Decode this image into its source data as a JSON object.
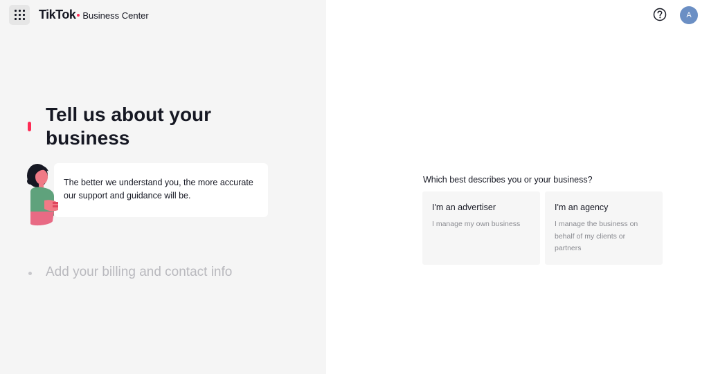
{
  "header": {
    "brand_name": "TikTok",
    "brand_product": "Business Center",
    "apps_icon": "grid-icon",
    "help_icon": "question-circle-icon",
    "avatar_initial": "A",
    "avatar_color": "#6b8fc4"
  },
  "steps": {
    "current": {
      "title": "Tell us about your business",
      "hint": "The better we understand you, the more accurate our support and guidance will be."
    },
    "next": {
      "title": "Add your billing and contact info"
    }
  },
  "form": {
    "question": "Which best describes you or your business?",
    "options": [
      {
        "title": "I'm an advertiser",
        "description": "I manage my own business"
      },
      {
        "title": "I'm an agency",
        "description": "I manage the business on behalf of my clients or partners"
      }
    ]
  },
  "colors": {
    "accent": "#fe2c55",
    "left_panel_bg": "#f5f5f5",
    "card_bg": "#f6f6f6"
  }
}
